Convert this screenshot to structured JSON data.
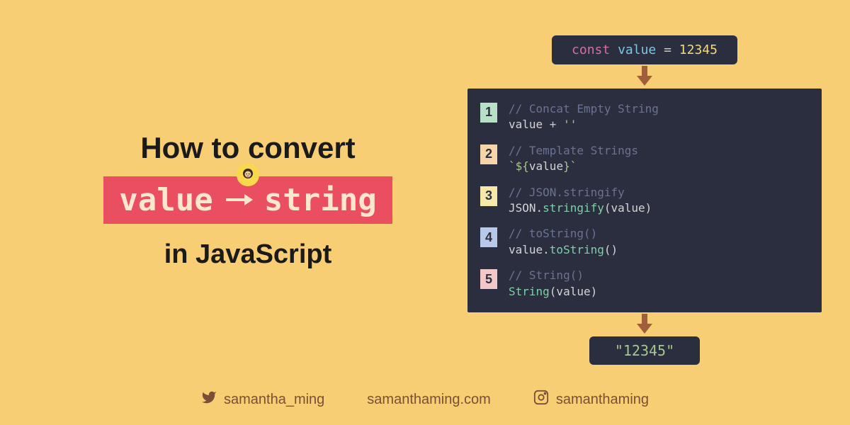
{
  "title": {
    "line1": "How to convert",
    "from": "value",
    "to": "string",
    "line2": "in JavaScript"
  },
  "declaration": {
    "keyword": "const",
    "name": "value",
    "op": "=",
    "literal": "12345"
  },
  "methods": [
    {
      "num": "1",
      "comment": "// Concat Empty String",
      "code_html": "value <span class='kw-op'>+</span> <span class='kw-str'>''</span>"
    },
    {
      "num": "2",
      "comment": "// Template Strings",
      "code_html": "<span class='kw-str'>`${</span>value<span class='kw-str'>}`</span>"
    },
    {
      "num": "3",
      "comment": "// JSON.stringify",
      "code_html": "JSON.<span class='kw-method'>stringify</span>(value)"
    },
    {
      "num": "4",
      "comment": "// toString()",
      "code_html": "value.<span class='kw-method'>toString</span>()"
    },
    {
      "num": "5",
      "comment": "// String()",
      "code_html": "<span class='kw-method'>String</span>(value)"
    }
  ],
  "output": "\"12345\"",
  "socials": {
    "twitter": "samantha_ming",
    "website": "samanthaming.com",
    "instagram": "samanthaming"
  }
}
